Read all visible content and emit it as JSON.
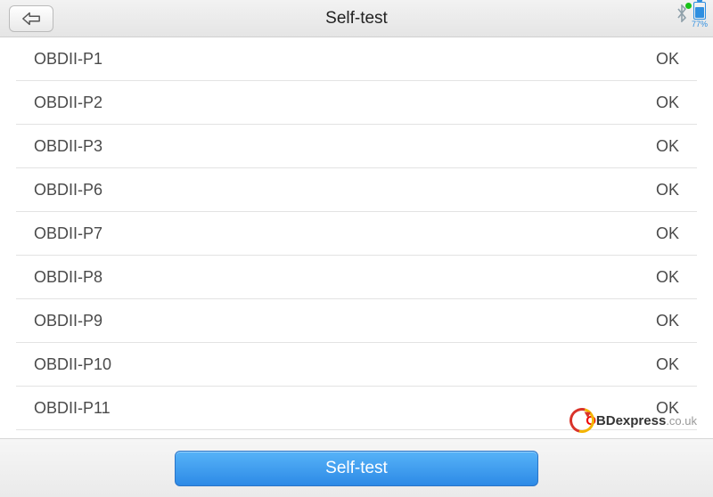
{
  "header": {
    "title": "Self-test",
    "battery_percent_label": "77%",
    "battery_fill_pct": 77
  },
  "results": [
    {
      "label": "OBDII-P1",
      "status": "OK"
    },
    {
      "label": "OBDII-P2",
      "status": "OK"
    },
    {
      "label": "OBDII-P3",
      "status": "OK"
    },
    {
      "label": "OBDII-P6",
      "status": "OK"
    },
    {
      "label": "OBDII-P7",
      "status": "OK"
    },
    {
      "label": "OBDII-P8",
      "status": "OK"
    },
    {
      "label": "OBDII-P9",
      "status": "OK"
    },
    {
      "label": "OBDII-P10",
      "status": "OK"
    },
    {
      "label": "OBDII-P11",
      "status": "OK"
    }
  ],
  "footer": {
    "primary_label": "Self-test"
  },
  "watermark": {
    "o": "O",
    "name": "BDexpress",
    "tld": ".co.uk"
  }
}
